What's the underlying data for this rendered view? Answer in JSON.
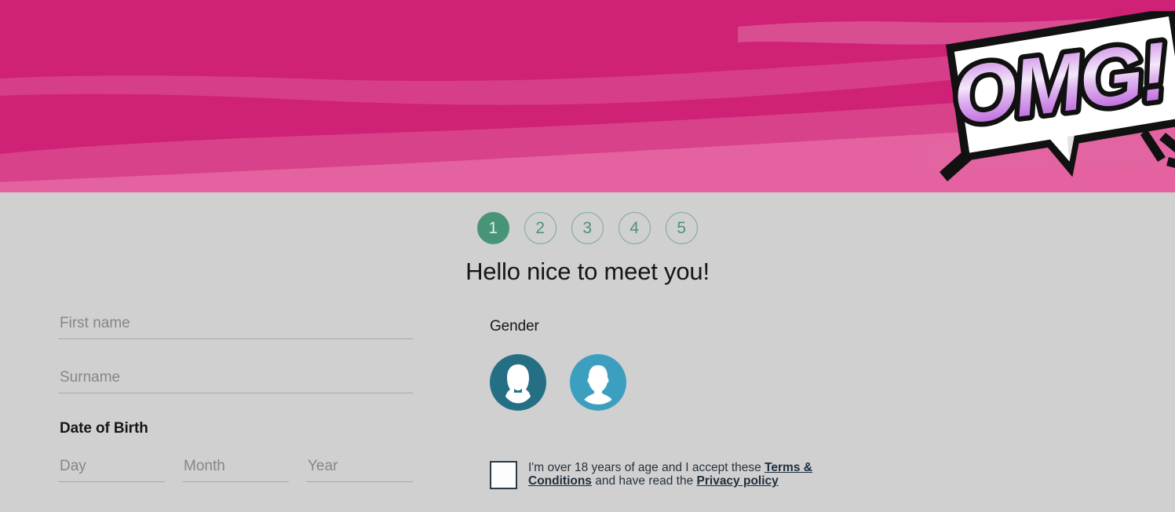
{
  "banner": {
    "colors": {
      "base": "#cf2176",
      "band_mid": "#d8428a",
      "band_light": "#e3629f",
      "band_lighter": "#e878ac"
    },
    "graphic": {
      "name": "omg-speech-bubble",
      "text": "OMG!",
      "bubble_fill": "#ffffff",
      "outline": "#111111",
      "text_gradient_top": "#c26fe0",
      "text_gradient_mid": "#f4e8fb",
      "text_gradient_bottom": "#b44ddb"
    }
  },
  "steps": {
    "active_color": "#489476",
    "inactive_color": "#4f9079",
    "items": [
      {
        "label": "1",
        "state": "active"
      },
      {
        "label": "2",
        "state": "inactive"
      },
      {
        "label": "3",
        "state": "inactive"
      },
      {
        "label": "4",
        "state": "inactive"
      },
      {
        "label": "5",
        "state": "inactive"
      }
    ]
  },
  "heading": "Hello nice to meet you!",
  "form": {
    "first_name": {
      "value": "",
      "placeholder": "First name"
    },
    "surname": {
      "value": "",
      "placeholder": "Surname"
    },
    "dob_label": "Date of Birth",
    "day": {
      "value": "",
      "placeholder": "Day"
    },
    "month": {
      "value": "",
      "placeholder": "Month"
    },
    "year": {
      "value": "",
      "placeholder": "Year"
    }
  },
  "gender": {
    "label": "Gender",
    "options": [
      {
        "name": "female",
        "color": "#256f85"
      },
      {
        "name": "male",
        "color": "#3d9fc0"
      }
    ]
  },
  "terms": {
    "checked": false,
    "text_before": "I'm over 18 years of age and I accept these ",
    "link_terms": "Terms & Conditions",
    "text_middle": " and have read the ",
    "link_privacy": "Privacy policy"
  }
}
